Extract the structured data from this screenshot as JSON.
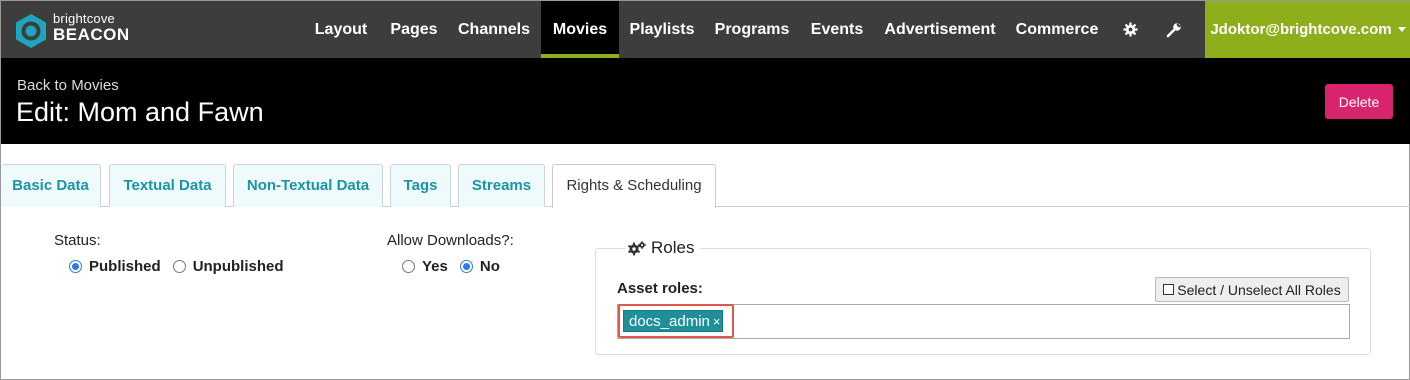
{
  "brand": {
    "small": "brightcove",
    "big": "BEACON"
  },
  "nav": {
    "items": [
      {
        "label": "Layout"
      },
      {
        "label": "Pages"
      },
      {
        "label": "Channels"
      },
      {
        "label": "Movies",
        "active": true
      },
      {
        "label": "Playlists"
      },
      {
        "label": "Programs"
      },
      {
        "label": "Events"
      },
      {
        "label": "Advertisement"
      },
      {
        "label": "Commerce"
      }
    ],
    "settings_icon": "gear-icon",
    "tools_icon": "wrench-icon",
    "user": "Jdoktor@brightcove.com"
  },
  "header": {
    "back_link": "Back to Movies",
    "title": "Edit: Mom and Fawn",
    "delete_label": "Delete"
  },
  "tabs": [
    {
      "label": "Basic Data"
    },
    {
      "label": "Textual Data"
    },
    {
      "label": "Non-Textual Data"
    },
    {
      "label": "Tags"
    },
    {
      "label": "Streams"
    },
    {
      "label": "Rights & Scheduling",
      "active": true
    }
  ],
  "status": {
    "label": "Status:",
    "options": [
      {
        "label": "Published",
        "checked": true
      },
      {
        "label": "Unpublished",
        "checked": false
      }
    ]
  },
  "downloads": {
    "label": "Allow Downloads?:",
    "options": [
      {
        "label": "Yes",
        "checked": false
      },
      {
        "label": "No",
        "checked": true
      }
    ]
  },
  "roles": {
    "legend": "Roles",
    "legend_icon": "gears-icon",
    "asset_roles_label": "Asset roles:",
    "select_all_label": "Select / Unselect All Roles",
    "selected": [
      {
        "label": "docs_admin"
      }
    ],
    "remove_glyph": "×"
  },
  "colors": {
    "navbar": "#3d3d3d",
    "accent": "#8fae1b",
    "delete": "#d8246f",
    "tab_text": "#1b94a8",
    "chip": "#1f8f9a",
    "highlight": "#e0584b"
  }
}
